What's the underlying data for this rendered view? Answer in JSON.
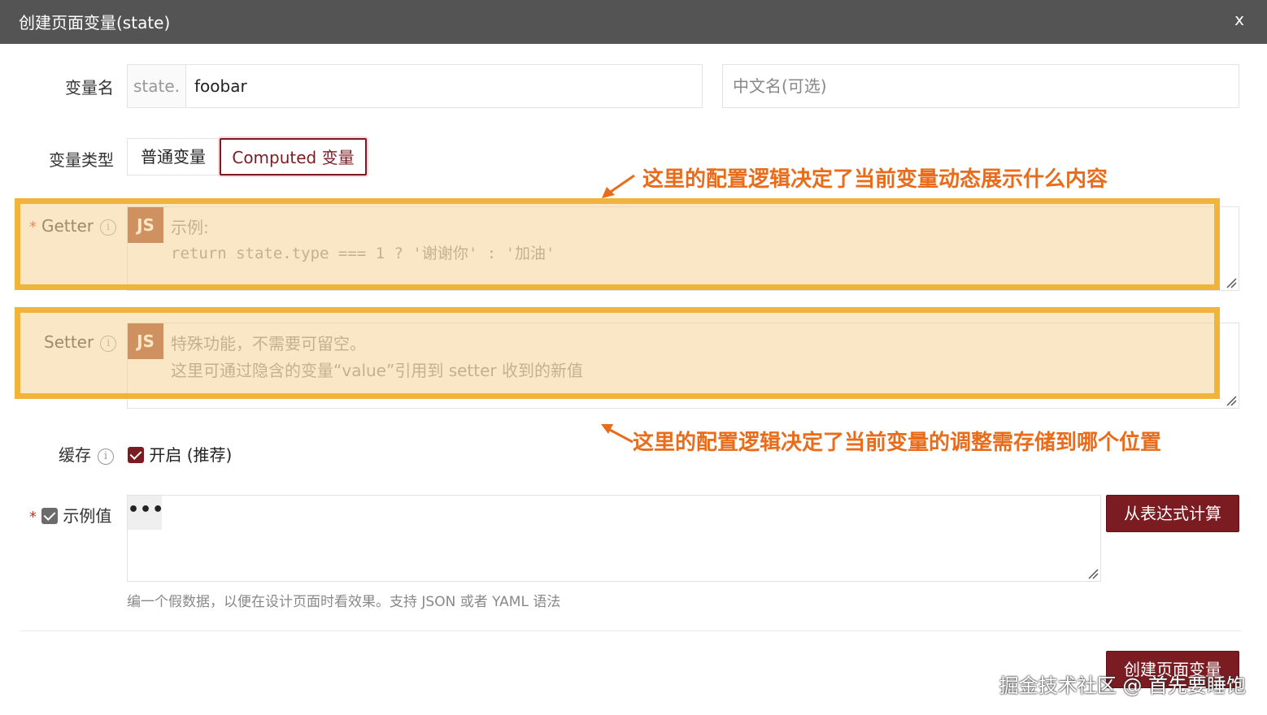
{
  "dialog": {
    "title": "创建页面变量(state)",
    "close_label": "x"
  },
  "var_name": {
    "label": "变量名",
    "prefix": "state.",
    "value": "foobar",
    "cn_placeholder": "中文名(可选)"
  },
  "var_type": {
    "label": "变量类型",
    "options": [
      "普通变量",
      "Computed 变量"
    ],
    "selected": "Computed 变量"
  },
  "getter": {
    "required_mark": "*",
    "label": "Getter",
    "info_icon": "i",
    "badge": "JS",
    "placeholder_line1": "示例:",
    "placeholder_line2": "return state.type === 1 ? '谢谢你' : '加油'"
  },
  "setter": {
    "label": "Setter",
    "info_icon": "i",
    "badge": "JS",
    "placeholder_line1": "特殊功能，不需要可留空。",
    "placeholder_line2": "这里可通过隐含的变量“value”引用到 setter 收到的新值"
  },
  "cache": {
    "label": "缓存",
    "info_icon": "i",
    "checkbox_label": "开启 (推荐)",
    "checked": true
  },
  "example": {
    "required_mark": "*",
    "label": "示例值",
    "checked": true,
    "more_label": "•••",
    "compute_button": "从表达式计算",
    "hint": "编一个假数据，以便在设计页面时看效果。支持 JSON 或者 YAML 语法"
  },
  "annotations": {
    "getter_note": "这里的配置逻辑决定了当前变量动态展示什么内容",
    "setter_note": "这里的配置逻辑决定了当前变量的调整需存储到哪个位置"
  },
  "footer": {
    "submit_button": "创建页面变量"
  },
  "watermark": "掘金技术社区 @ 首先要睡饱",
  "colors": {
    "titlebar": "#545454",
    "brand": "#7a1c22",
    "js_badge": "#a2411f",
    "highlight_border": "#f0b43a",
    "annotation": "#e86c1b"
  }
}
